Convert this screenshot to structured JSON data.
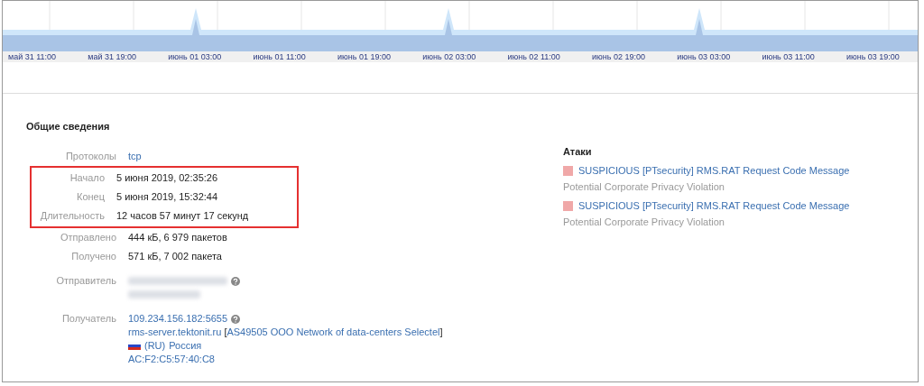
{
  "timeline": {
    "labels": [
      "май 31 11:00",
      "май 31 19:00",
      "июнь 01 03:00",
      "июнь 01 11:00",
      "июнь 01 19:00",
      "июнь 02 03:00",
      "июнь 02 11:00",
      "июнь 02 19:00",
      "июнь 03 03:00",
      "июнь 03 11:00",
      "июнь 03 19:00"
    ]
  },
  "general": {
    "title": "Общие сведения",
    "rows": [
      {
        "label": "Протоколы",
        "kind": "link",
        "value": "tcp",
        "highlighted": false
      },
      {
        "label": "Начало",
        "kind": "text",
        "value": "5 июня 2019, 02:35:26",
        "highlighted": true
      },
      {
        "label": "Конец",
        "kind": "text",
        "value": "5 июня 2019, 15:32:44",
        "highlighted": true
      },
      {
        "label": "Длительность",
        "kind": "text",
        "value": "12 часов 57 минут 17 секунд",
        "highlighted": true
      },
      {
        "label": "Отправлено",
        "kind": "text",
        "value": "444 кБ, 6 979 пакетов",
        "highlighted": false
      },
      {
        "label": "Получено",
        "kind": "text",
        "value": "571 кБ, 7 002 пакета",
        "highlighted": false
      },
      {
        "label": "Отправитель",
        "kind": "redacted",
        "highlighted": false
      },
      {
        "label": "Получатель",
        "kind": "host",
        "highlighted": false,
        "address": "109.234.156.182:5655",
        "hostname": "rms-server.tektonit.ru",
        "as_open": "[",
        "as_link": "AS49505 OOO Network of data-centers Selectel",
        "as_close": "]",
        "country_code": "(RU)",
        "country": "Россия",
        "mac": "AC:F2:C5:57:40:C8"
      }
    ]
  },
  "attacks": {
    "title": "Атаки",
    "items": [
      {
        "name": "SUSPICIOUS [PTsecurity] RMS.RAT Request Code Message",
        "category": "Potential Corporate Privacy Violation",
        "color": "#f0a8a8"
      },
      {
        "name": "SUSPICIOUS [PTsecurity] RMS.RAT Request Code Message",
        "category": "Potential Corporate Privacy Violation",
        "color": "#f0a8a8"
      }
    ]
  }
}
